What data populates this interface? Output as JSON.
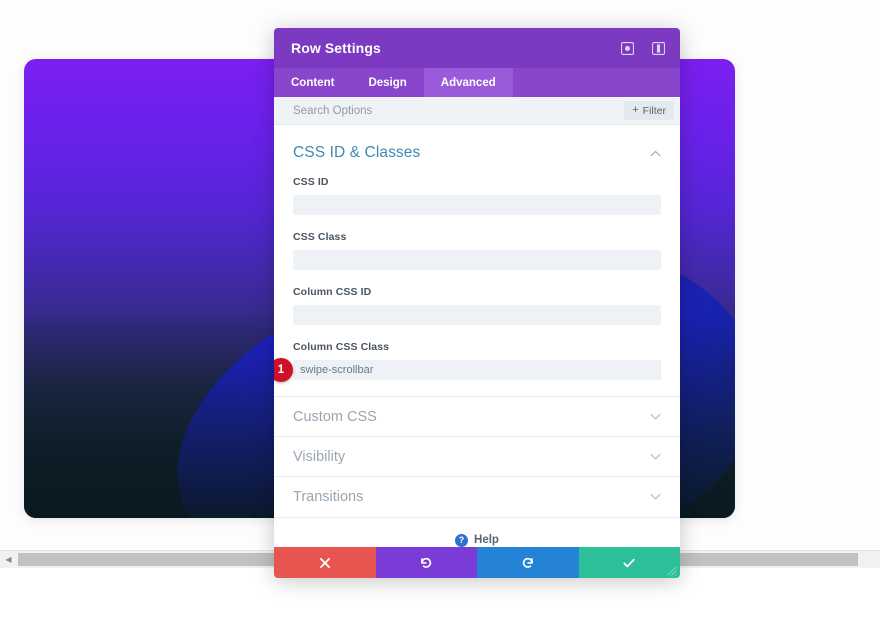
{
  "modal": {
    "title": "Row Settings",
    "header_icons": [
      {
        "name": "fullscreen-icon",
        "glyph": "⊙"
      },
      {
        "name": "layout-panel-icon",
        "glyph": "▣"
      }
    ],
    "tabs": [
      {
        "label": "Content",
        "active": false
      },
      {
        "label": "Design",
        "active": false
      },
      {
        "label": "Advanced",
        "active": true
      }
    ],
    "search": {
      "placeholder": "Search Options",
      "value": ""
    },
    "filter_button": {
      "label": "Filter",
      "plus": "+"
    },
    "sections": {
      "open": {
        "title": "CSS ID & Classes",
        "chevron": "⌃",
        "fields": [
          {
            "label": "CSS ID",
            "value": "",
            "placeholder": "",
            "badge": null
          },
          {
            "label": "CSS Class",
            "value": "",
            "placeholder": "",
            "badge": null
          },
          {
            "label": "Column CSS ID",
            "value": "",
            "placeholder": "",
            "badge": null
          },
          {
            "label": "Column CSS Class",
            "value": "swipe-scrollbar",
            "placeholder": "",
            "badge": "1"
          }
        ]
      },
      "collapsed": [
        {
          "title": "Custom CSS",
          "chevron": "⌄"
        },
        {
          "title": "Visibility",
          "chevron": "⌄"
        },
        {
          "title": "Transitions",
          "chevron": "⌄"
        }
      ]
    },
    "help": {
      "icon_glyph": "?",
      "label": "Help"
    },
    "footer_buttons": [
      {
        "name": "cancel-button",
        "glyph": "✖",
        "color": "#e8544f"
      },
      {
        "name": "undo-button",
        "glyph": "↺",
        "color": "#7a3bd6"
      },
      {
        "name": "redo-button",
        "glyph": "↻",
        "color": "#2483d6"
      },
      {
        "name": "save-button",
        "glyph": "✔",
        "color": "#2cbf9a"
      }
    ]
  },
  "background": {
    "hero_gradient_top": "#7b1ff0",
    "hero_gradient_bottom": "#0c1c24",
    "blob_color": "#1d1fd2"
  },
  "scrollbar": {
    "left_arrow_glyph": "◀"
  },
  "colors": {
    "header_purple": "#7b3ac1",
    "tabs_purple": "#8a45cd",
    "tab_active_purple": "#9a5ada",
    "section_title_blue": "#3f8ab0",
    "badge_red": "#cf1126"
  }
}
